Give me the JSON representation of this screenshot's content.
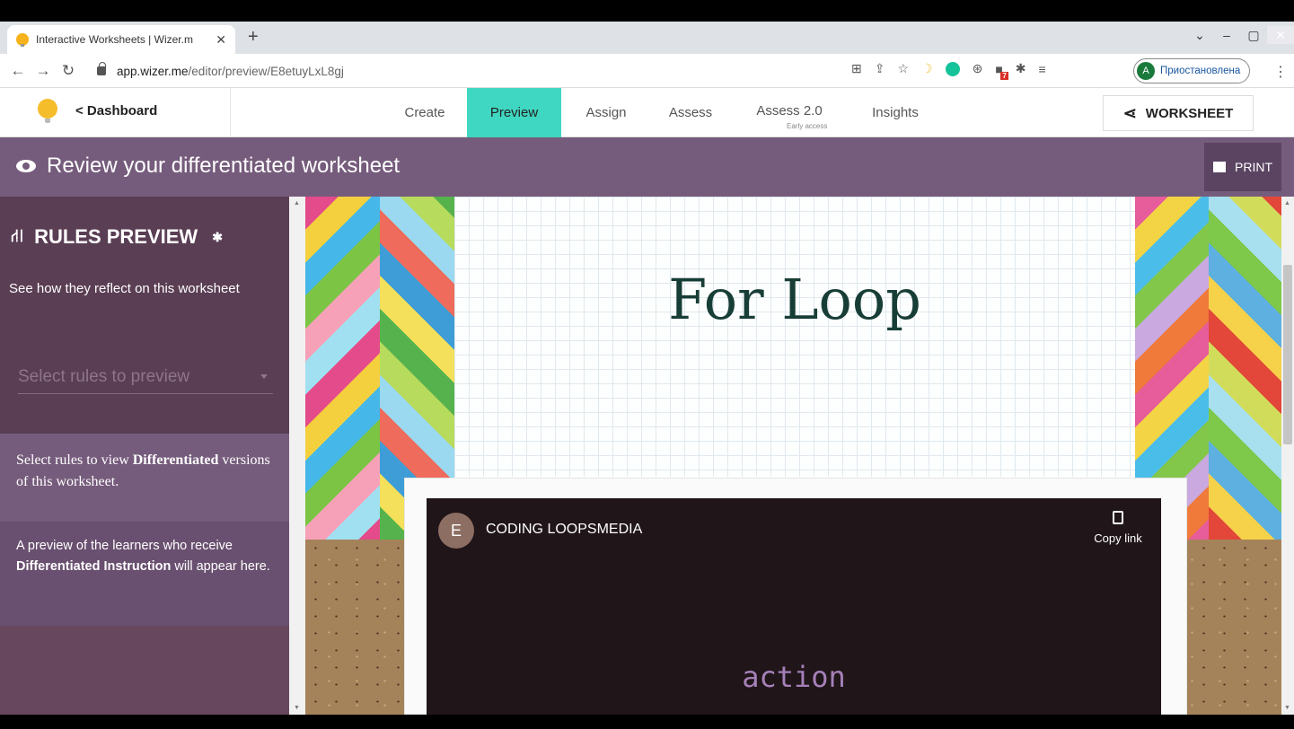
{
  "browser": {
    "tab_title": "Interactive Worksheets | Wizer.m",
    "tab_close": "✕",
    "new_tab": "+",
    "url_host": "app.wizer.me",
    "url_path": "/editor/preview/E8etuyLxL8gj",
    "profile_initial": "A",
    "profile_status": "Приостановлена",
    "window_controls": [
      "⌄",
      "–",
      "▢",
      "✕"
    ]
  },
  "header": {
    "back_label": "< Dashboard",
    "tabs": [
      {
        "label": "Create"
      },
      {
        "label": "Preview"
      },
      {
        "label": "Assign"
      },
      {
        "label": "Assess"
      },
      {
        "label": "Assess 2.0"
      },
      {
        "label": "Insights"
      }
    ],
    "assess2_sub": "Early access",
    "worksheet_label": "WORKSHEET",
    "active_tab": "Preview",
    "accent": "#3fd7c1"
  },
  "band": {
    "title": "Review your differentiated worksheet",
    "print_label": "PRINT",
    "color": "#765c7c"
  },
  "sidebar": {
    "heading": "RULES PREVIEW",
    "description": "See how they reflect on this worksheet",
    "select_placeholder": "Select rules to preview",
    "info1_prefix": "Select rules to view ",
    "info1_bold": "Differentiated",
    "info1_suffix": " versions of this worksheet.",
    "info2_prefix": "A preview of the learners who receive ",
    "info2_bold": "Differentiated Instruction",
    "info2_suffix": " will appear here."
  },
  "worksheet": {
    "title": "For Loop",
    "video": {
      "avatar_letter": "E",
      "channel_title": "CODING LOOPSMEDIA",
      "copy_label": "Copy link",
      "overlay_text": "action"
    }
  }
}
